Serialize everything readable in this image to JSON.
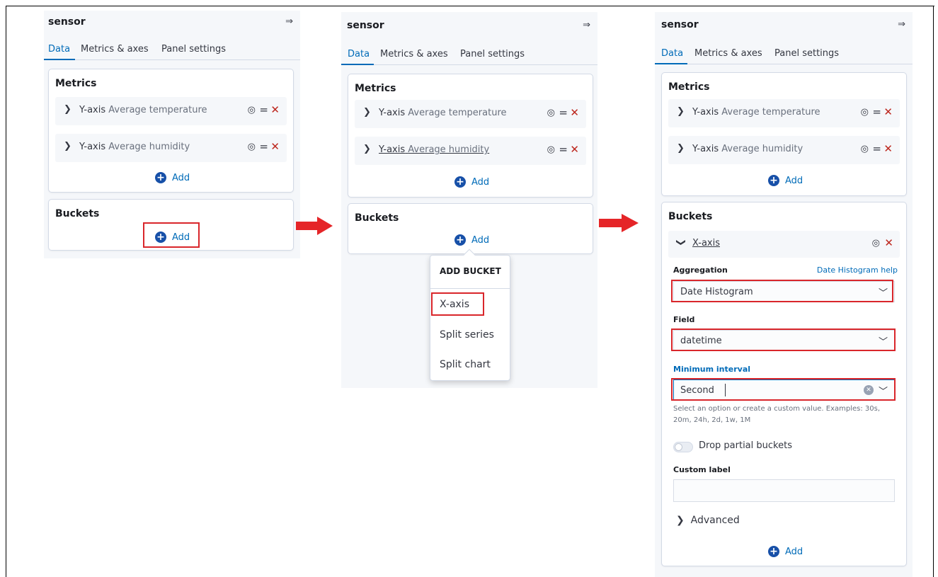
{
  "panel_title": "sensor",
  "collapse_icon": "collapse-right-icon",
  "tabs": [
    "Data",
    "Metrics & axes",
    "Panel settings"
  ],
  "metrics": {
    "title": "Metrics",
    "items": [
      {
        "axis": "Y-axis",
        "description": "Average temperature"
      },
      {
        "axis": "Y-axis",
        "description": "Average humidity"
      }
    ],
    "add_label": "Add"
  },
  "buckets": {
    "title": "Buckets",
    "add_label": "Add"
  },
  "add_bucket_menu": {
    "title": "ADD BUCKET",
    "options": [
      "X-axis",
      "Split series",
      "Split chart"
    ]
  },
  "xaxis_editor": {
    "name": "X-axis",
    "aggregation_label": "Aggregation",
    "aggregation_help": "Date Histogram help",
    "aggregation_value": "Date Histogram",
    "field_label": "Field",
    "field_value": "datetime",
    "interval_label": "Minimum interval",
    "interval_value": "Second",
    "interval_help": "Select an option or create a custom value. Examples: 30s, 20m, 24h, 2d, 1w, 1M",
    "drop_partial_label": "Drop partial buckets",
    "drop_partial_enabled": false,
    "custom_label_label": "Custom label",
    "custom_label_value": "",
    "advanced_label": "Advanced",
    "add_label": "Add"
  },
  "colors": {
    "accent": "#006bb8",
    "delete": "#bd271e",
    "highlight_box": "#d9262b",
    "arrow": "#e52528"
  }
}
